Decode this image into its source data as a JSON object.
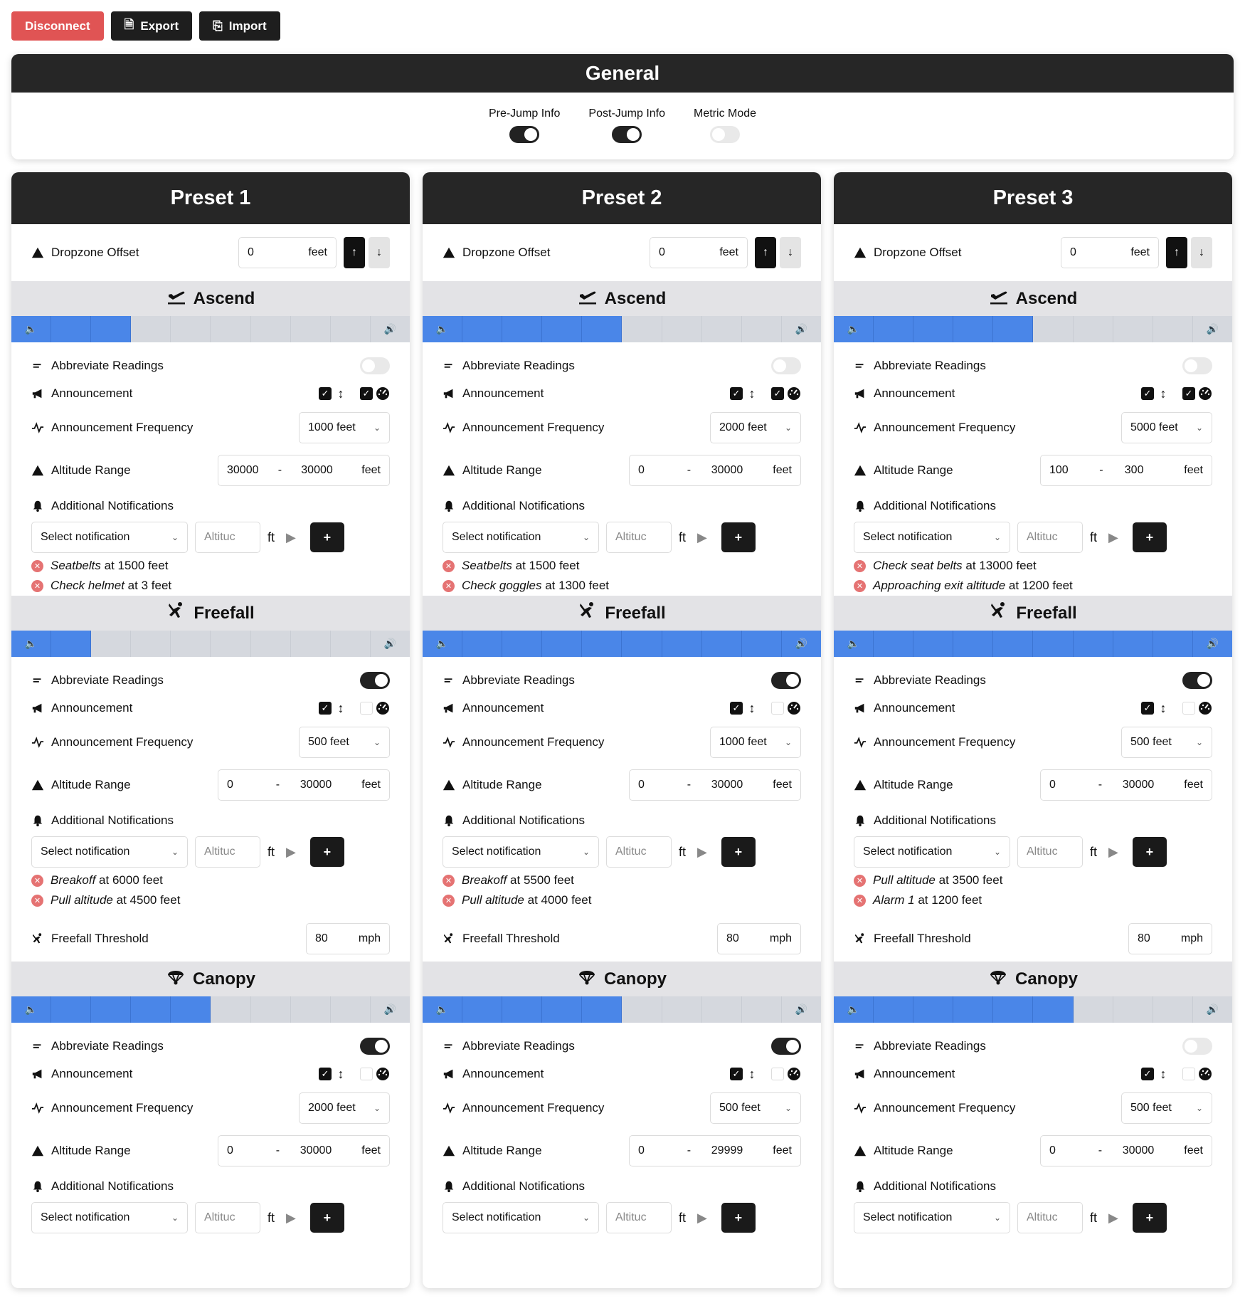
{
  "toolbar": {
    "disconnect": "Disconnect",
    "export": "Export",
    "import": "Import"
  },
  "general": {
    "title": "General",
    "toggles": [
      {
        "label": "Pre-Jump Info",
        "on": true
      },
      {
        "label": "Post-Jump Info",
        "on": true
      },
      {
        "label": "Metric Mode",
        "on": false
      }
    ]
  },
  "labels": {
    "dropzone_offset": "Dropzone Offset",
    "feet": "feet",
    "abbreviate": "Abbreviate Readings",
    "announcement": "Announcement",
    "frequency": "Announcement Frequency",
    "altitude_range": "Altitude Range",
    "additional": "Additional Notifications",
    "select_notification": "Select notification",
    "altitude_placeholder": "Altituc",
    "ft": "ft",
    "plus": "+",
    "dash": "-",
    "freefall_threshold": "Freefall Threshold",
    "mph": "mph",
    "at": "at"
  },
  "presets": [
    {
      "title": "Preset 1",
      "offset": "0",
      "sections": [
        {
          "name": "Ascend",
          "volume": 3,
          "abbreviate": false,
          "ann_alt": true,
          "ann_speed": true,
          "frequency": "1000 feet",
          "alt_min": "30000",
          "alt_max": "30000",
          "notifications": [
            {
              "name": "Seatbelts",
              "alt": "1500 feet"
            },
            {
              "name": "Check helmet",
              "alt": "3 feet"
            }
          ]
        },
        {
          "name": "Freefall",
          "volume": 2,
          "abbreviate": true,
          "ann_alt": true,
          "ann_speed": false,
          "frequency": "500 feet",
          "alt_min": "0",
          "alt_max": "30000",
          "notifications": [
            {
              "name": "Breakoff",
              "alt": "6000 feet"
            },
            {
              "name": "Pull altitude",
              "alt": "4500 feet"
            }
          ],
          "threshold": "80"
        },
        {
          "name": "Canopy",
          "volume": 5,
          "abbreviate": true,
          "ann_alt": true,
          "ann_speed": false,
          "frequency": "2000 feet",
          "alt_min": "0",
          "alt_max": "30000",
          "notifications": []
        }
      ]
    },
    {
      "title": "Preset 2",
      "offset": "0",
      "sections": [
        {
          "name": "Ascend",
          "volume": 5,
          "abbreviate": false,
          "ann_alt": true,
          "ann_speed": true,
          "frequency": "2000 feet",
          "alt_min": "0",
          "alt_max": "30000",
          "notifications": [
            {
              "name": "Seatbelts",
              "alt": "1500 feet"
            },
            {
              "name": "Check goggles",
              "alt": "1300 feet"
            }
          ]
        },
        {
          "name": "Freefall",
          "volume": 10,
          "abbreviate": true,
          "ann_alt": true,
          "ann_speed": false,
          "frequency": "1000 feet",
          "alt_min": "0",
          "alt_max": "30000",
          "notifications": [
            {
              "name": "Breakoff",
              "alt": "5500 feet"
            },
            {
              "name": "Pull altitude",
              "alt": "4000 feet"
            }
          ],
          "threshold": "80"
        },
        {
          "name": "Canopy",
          "volume": 5,
          "abbreviate": true,
          "ann_alt": true,
          "ann_speed": false,
          "frequency": "500 feet",
          "alt_min": "0",
          "alt_max": "29999",
          "notifications": []
        }
      ]
    },
    {
      "title": "Preset 3",
      "offset": "0",
      "sections": [
        {
          "name": "Ascend",
          "volume": 5,
          "abbreviate": false,
          "ann_alt": true,
          "ann_speed": true,
          "frequency": "5000 feet",
          "alt_min": "100",
          "alt_max": "300",
          "notifications": [
            {
              "name": "Check seat belts",
              "alt": "13000 feet"
            },
            {
              "name": "Approaching exit altitude",
              "alt": "1200 feet"
            }
          ]
        },
        {
          "name": "Freefall",
          "volume": 10,
          "abbreviate": true,
          "ann_alt": true,
          "ann_speed": false,
          "frequency": "500 feet",
          "alt_min": "0",
          "alt_max": "30000",
          "notifications": [
            {
              "name": "Pull altitude",
              "alt": "3500 feet"
            },
            {
              "name": "Alarm 1",
              "alt": "1200 feet"
            }
          ],
          "threshold": "80"
        },
        {
          "name": "Canopy",
          "volume": 6,
          "abbreviate": false,
          "ann_alt": true,
          "ann_speed": false,
          "frequency": "500 feet",
          "alt_min": "0",
          "alt_max": "30000",
          "notifications": []
        }
      ]
    }
  ]
}
